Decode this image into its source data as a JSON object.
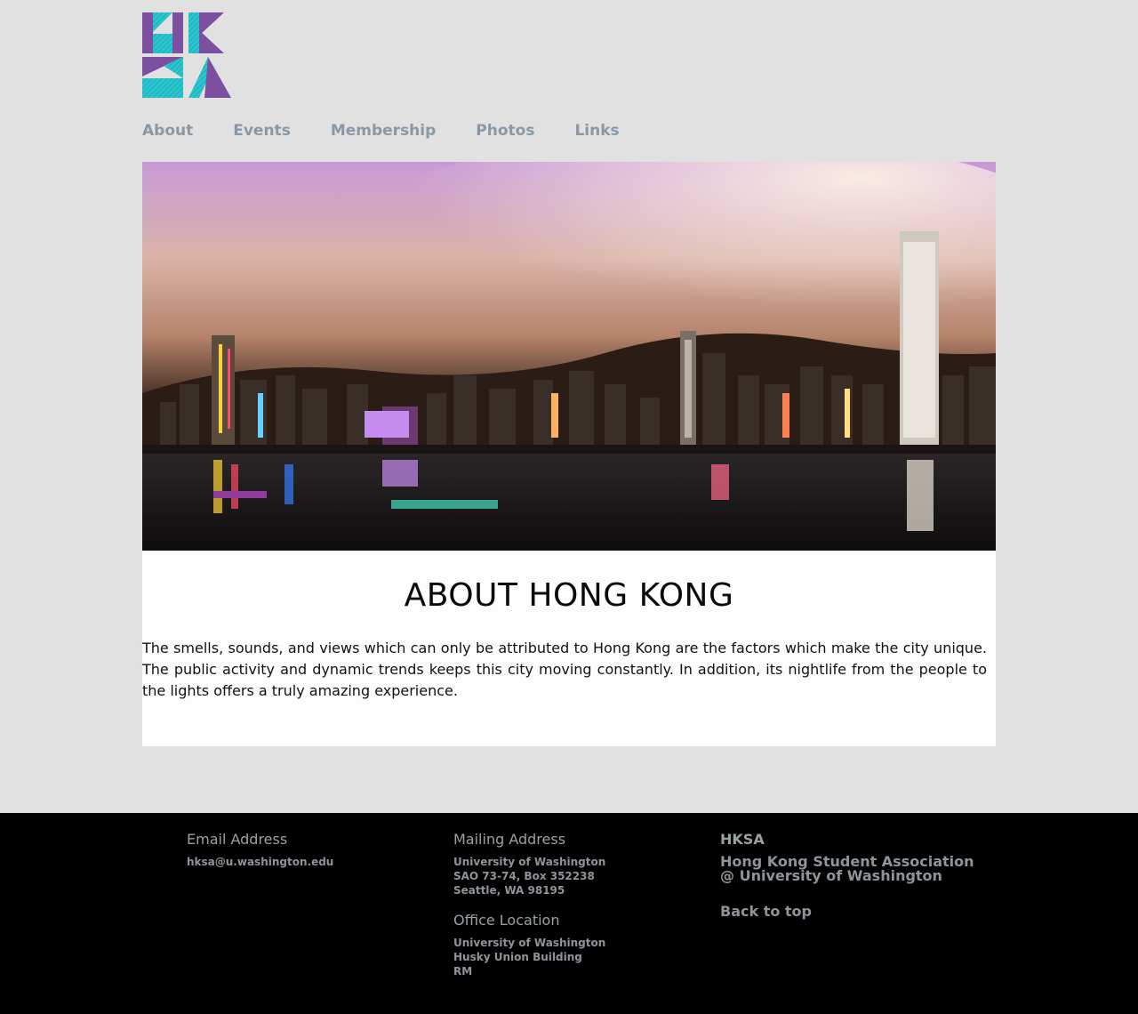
{
  "logo": {
    "text": "HKSA"
  },
  "nav": {
    "items": [
      "About",
      "Events",
      "Membership",
      "Photos",
      "Links"
    ]
  },
  "main": {
    "title": "ABOUT HONG KONG",
    "body": "The smells, sounds, and views which can only be attributed to Hong Kong are the factors which make the city unique. The public activity and dynamic trends keeps this city moving constantly. In addition, its nightlife from the people to the lights offers a truly amazing experience."
  },
  "footer": {
    "email": {
      "heading": "Email Address",
      "value": "hksa@u.washington.edu"
    },
    "mailing": {
      "heading": "Mailing Address",
      "lines": [
        "University of Washington",
        "SAO 73-74, Box 352238",
        "Seattle, WA 98195"
      ]
    },
    "office": {
      "heading": "Office Location",
      "lines": [
        "University of Washington",
        "Husky Union Building",
        "RM"
      ]
    },
    "org": {
      "heading": "HKSA",
      "name_line1": "Hong Kong Student Association",
      "name_line2": "@ University of Washington",
      "back_to_top": "Back to top"
    }
  },
  "colors": {
    "logo_purple": "#7c4fa0",
    "logo_teal": "#29c6cf",
    "nav_text": "#8a98a6",
    "page_bg": "#e1e1e1",
    "footer_bg": "#000000"
  }
}
